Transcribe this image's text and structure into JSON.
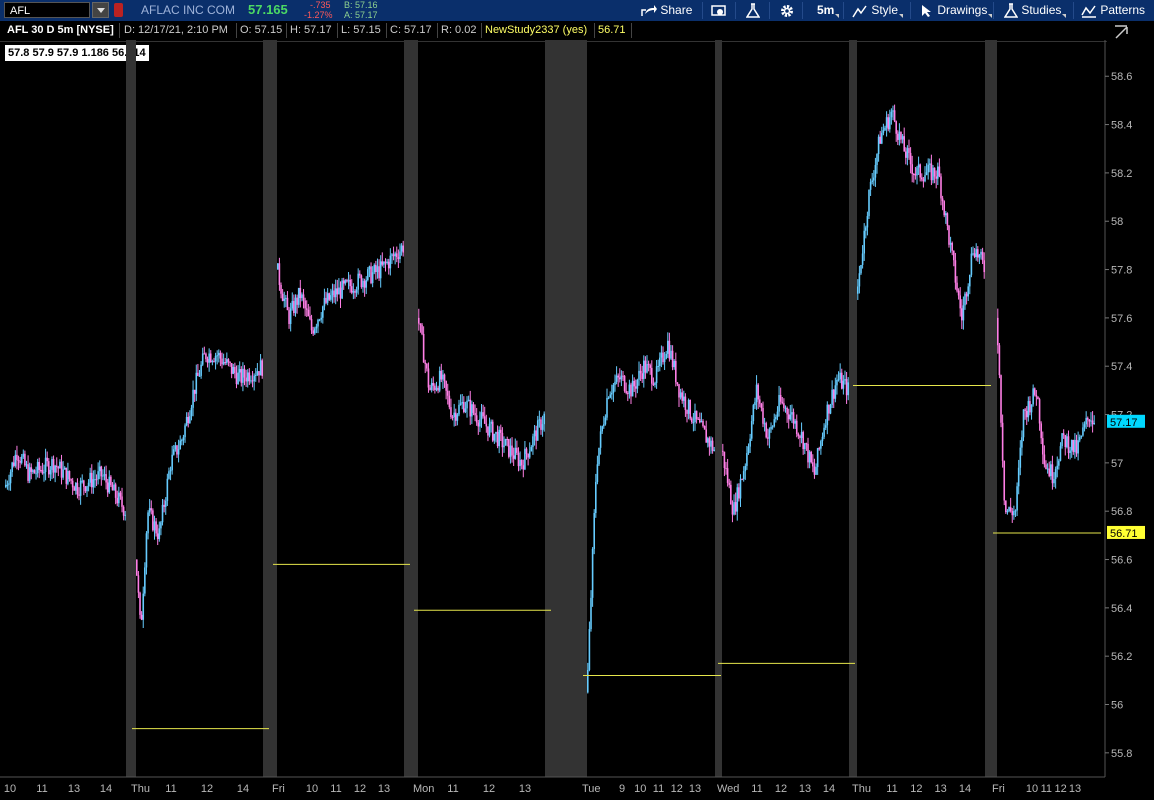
{
  "toolbar": {
    "symbol": "AFL",
    "company": "AFLAC INC COM",
    "last": "57.165",
    "change": "-.735",
    "change_pct": "-1.27%",
    "bid": "B: 57.16",
    "ask": "A: 57.17",
    "share_label": "Share",
    "period_label": "5m",
    "style_label": "Style",
    "drawings_label": "Drawings",
    "studies_label": "Studies",
    "patterns_label": "Patterns",
    "icons": [
      "share-icon",
      "screen-icon",
      "flask-icon",
      "gear-icon",
      "style-icon",
      "cursor-icon",
      "studies-icon",
      "patterns-icon"
    ]
  },
  "infobar": {
    "title": "AFL 30 D 5m [NYSE]",
    "date": "D: 12/17/21, 2:10 PM",
    "open": "O: 57.15",
    "high": "H: 57.17",
    "low": "L: 57.15",
    "close": "C: 57.17",
    "range": "R: 0.02",
    "study": "NewStudy2337 (yes)",
    "study_value": "56.71"
  },
  "databox": "57.8 57.9 57.9 1.186 56.714",
  "colors": {
    "up": "#66ccff",
    "down": "#ff7fe6",
    "study": "#e6e64c",
    "premarket": "#333333",
    "last_badge": "#00d8ff",
    "study_badge": "#ffff33"
  },
  "chart_data": {
    "type": "candlestick",
    "ylim": [
      55.7,
      58.75
    ],
    "y_ticks": [
      "55.8",
      "56",
      "56.2",
      "56.4",
      "56.6",
      "56.8",
      "57",
      "57.2",
      "57.4",
      "57.6",
      "57.8",
      "58",
      "58.2",
      "58.4",
      "58.6"
    ],
    "last_price_label": "57.17",
    "study_price_label": "56.71",
    "sessions": [
      {
        "day": "",
        "hours": [
          "10",
          "11",
          "13",
          "14"
        ],
        "path": [
          [
            10,
            56.9
          ],
          [
            10.5,
            57.05
          ],
          [
            11,
            56.95
          ],
          [
            12,
            57.0
          ],
          [
            13,
            56.9
          ],
          [
            14,
            56.95
          ],
          [
            15,
            56.8
          ]
        ],
        "level": null
      },
      {
        "day": "Thu",
        "hours": [
          "11",
          "12",
          "14"
        ],
        "path": [
          [
            9.5,
            56.6
          ],
          [
            9.7,
            56.3
          ],
          [
            10,
            56.8
          ],
          [
            10.5,
            56.7
          ],
          [
            11,
            57.0
          ],
          [
            11.5,
            57.1
          ],
          [
            12,
            57.3
          ],
          [
            12.5,
            57.45
          ],
          [
            13,
            57.45
          ],
          [
            14,
            57.35
          ],
          [
            15,
            57.4
          ]
        ],
        "level": 55.9
      },
      {
        "day": "Fri",
        "hours": [
          "10",
          "11",
          "12",
          "13"
        ],
        "path": [
          [
            9.5,
            57.8
          ],
          [
            10,
            57.6
          ],
          [
            10.5,
            57.7
          ],
          [
            11,
            57.55
          ],
          [
            11.5,
            57.65
          ],
          [
            12,
            57.7
          ],
          [
            13,
            57.75
          ],
          [
            14,
            57.8
          ],
          [
            15,
            57.9
          ]
        ],
        "level": 56.58
      },
      {
        "day": "Mon",
        "hours": [
          "11",
          "12",
          "13"
        ],
        "path": [
          [
            9.5,
            57.6
          ],
          [
            10,
            57.3
          ],
          [
            10.5,
            57.35
          ],
          [
            11,
            57.2
          ],
          [
            11.5,
            57.25
          ],
          [
            12,
            57.2
          ],
          [
            13,
            57.1
          ],
          [
            13.5,
            57.05
          ],
          [
            14,
            57.0
          ],
          [
            15,
            57.2
          ]
        ],
        "level": 56.39
      },
      {
        "day": "Tue",
        "hours": [
          "9",
          "10",
          "11",
          "12",
          "13"
        ],
        "path": [
          [
            9.6,
            56.05
          ],
          [
            10,
            57.0
          ],
          [
            10.5,
            57.3
          ],
          [
            11,
            57.35
          ],
          [
            11.5,
            57.3
          ],
          [
            12,
            57.4
          ],
          [
            12.5,
            57.35
          ],
          [
            13,
            57.5
          ],
          [
            13.5,
            57.3
          ],
          [
            14,
            57.2
          ],
          [
            15,
            57.05
          ]
        ],
        "level": 56.12
      },
      {
        "day": "Wed",
        "hours": [
          "11",
          "12",
          "13",
          "14"
        ],
        "path": [
          [
            9.5,
            57.05
          ],
          [
            10,
            56.8
          ],
          [
            10.5,
            57.0
          ],
          [
            11,
            57.3
          ],
          [
            11.5,
            57.1
          ],
          [
            12,
            57.25
          ],
          [
            12.5,
            57.2
          ],
          [
            13,
            57.1
          ],
          [
            13.5,
            56.95
          ],
          [
            14,
            57.2
          ],
          [
            14.5,
            57.35
          ],
          [
            15,
            57.3
          ]
        ],
        "level": 56.17
      },
      {
        "day": "Thu",
        "hours": [
          "11",
          "12",
          "13",
          "14"
        ],
        "path": [
          [
            9.5,
            57.7
          ],
          [
            10,
            58.1
          ],
          [
            10.5,
            58.35
          ],
          [
            11,
            58.45
          ],
          [
            11.5,
            58.3
          ],
          [
            12,
            58.2
          ],
          [
            12.5,
            58.2
          ],
          [
            13,
            58.2
          ],
          [
            13.5,
            57.9
          ],
          [
            14,
            57.6
          ],
          [
            14.5,
            57.9
          ],
          [
            15,
            57.8
          ]
        ],
        "level": 57.32
      },
      {
        "day": "Fri",
        "hours": [
          "10",
          "11",
          "12",
          "13"
        ],
        "path": [
          [
            9.5,
            57.6
          ],
          [
            9.8,
            56.8
          ],
          [
            10.2,
            56.8
          ],
          [
            10.5,
            57.2
          ],
          [
            11,
            57.3
          ],
          [
            11.3,
            57.0
          ],
          [
            11.6,
            56.95
          ],
          [
            12,
            57.1
          ],
          [
            12.5,
            57.05
          ],
          [
            13,
            57.2
          ],
          [
            13.2,
            57.17
          ]
        ],
        "level": 56.71
      }
    ],
    "premarket_bands": [
      {
        "x0": 126,
        "x1": 136
      },
      {
        "x0": 263,
        "x1": 277
      },
      {
        "x0": 404,
        "x1": 418
      },
      {
        "x0": 545,
        "x1": 587
      },
      {
        "x0": 715,
        "x1": 722
      },
      {
        "x0": 849,
        "x1": 857
      },
      {
        "x0": 985,
        "x1": 997
      }
    ],
    "session_spans": [
      {
        "x0": 5,
        "x1": 126
      },
      {
        "x0": 136,
        "x1": 263
      },
      {
        "x0": 277,
        "x1": 404
      },
      {
        "x0": 418,
        "x1": 545
      },
      {
        "x0": 587,
        "x1": 715
      },
      {
        "x0": 722,
        "x1": 849
      },
      {
        "x0": 857,
        "x1": 985
      },
      {
        "x0": 997,
        "x1": 1095
      }
    ]
  }
}
